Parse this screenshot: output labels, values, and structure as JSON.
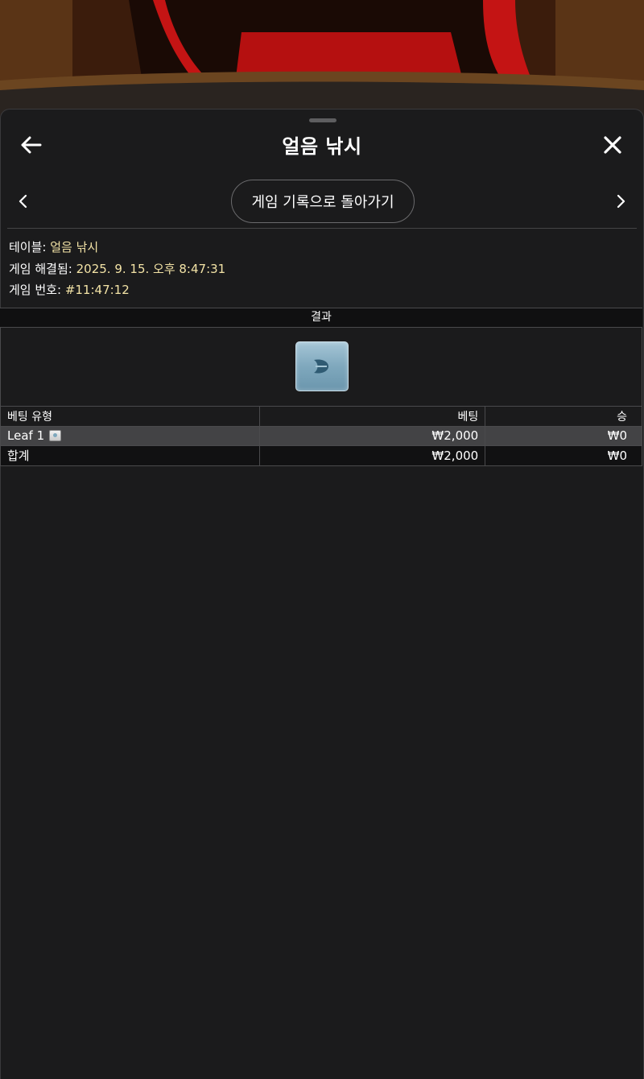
{
  "header": {
    "title": "얼음 낚시"
  },
  "nav": {
    "back_to_history_label": "게임 기록으로 돌아가기"
  },
  "info": {
    "table_label": "테이블:",
    "table_value": "얼음 낚시",
    "resolved_label": "게임 해결됨:",
    "resolved_value": "2025. 9. 15. 오후 8:47:31",
    "number_label": "게임 번호:",
    "number_value": "#11:47:12"
  },
  "results": {
    "heading": "결과",
    "tile_icon": "leaf-icon"
  },
  "bets": {
    "columns": [
      "베팅 유형",
      "베팅",
      "승"
    ],
    "rows": [
      {
        "type": "Leaf 1",
        "bet": "₩2,000",
        "win": "₩0"
      }
    ],
    "total": {
      "type": "합계",
      "bet": "₩2,000",
      "win": "₩0"
    }
  },
  "colors": {
    "background": "#1b1b1c",
    "value_text": "#f3e3a6",
    "highlight_row": "#434345"
  }
}
